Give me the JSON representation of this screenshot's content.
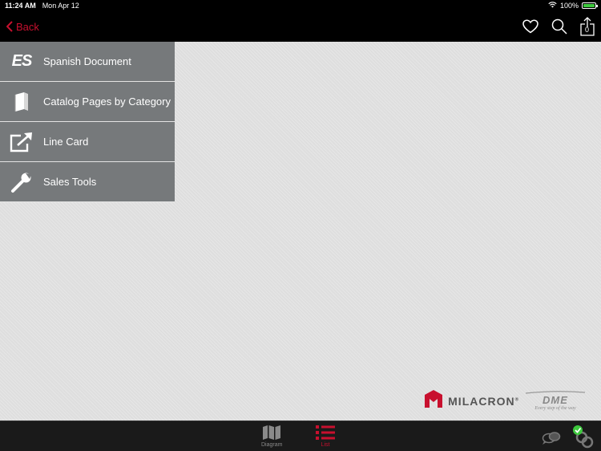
{
  "status_bar": {
    "time": "11:24 AM",
    "date": "Mon Apr 12",
    "battery": "100%",
    "battery_level": 1.0
  },
  "nav": {
    "back_label": "Back",
    "cart_count": "0",
    "icons": [
      "heart-icon",
      "search-icon",
      "share-icon"
    ]
  },
  "menu": {
    "items": [
      {
        "label": "Spanish Document",
        "icon": "es-icon",
        "icon_text": "ES"
      },
      {
        "label": "Catalog Pages by Category",
        "icon": "book-icon"
      },
      {
        "label": "Line Card",
        "icon": "external-link-icon"
      },
      {
        "label": "Sales Tools",
        "icon": "wrench-icon"
      }
    ]
  },
  "branding": {
    "milacron": "MILACRON",
    "dme": "DME",
    "dme_tagline": "Every step of the way"
  },
  "tabs": [
    {
      "label": "Diagram",
      "icon": "map-icon",
      "active": false
    },
    {
      "label": "List",
      "icon": "list-icon",
      "active": true
    }
  ],
  "colors": {
    "accent": "#c8102e",
    "menu_bg": "#76797b",
    "content_bg": "#dedede",
    "bar_bg": "#000000"
  }
}
